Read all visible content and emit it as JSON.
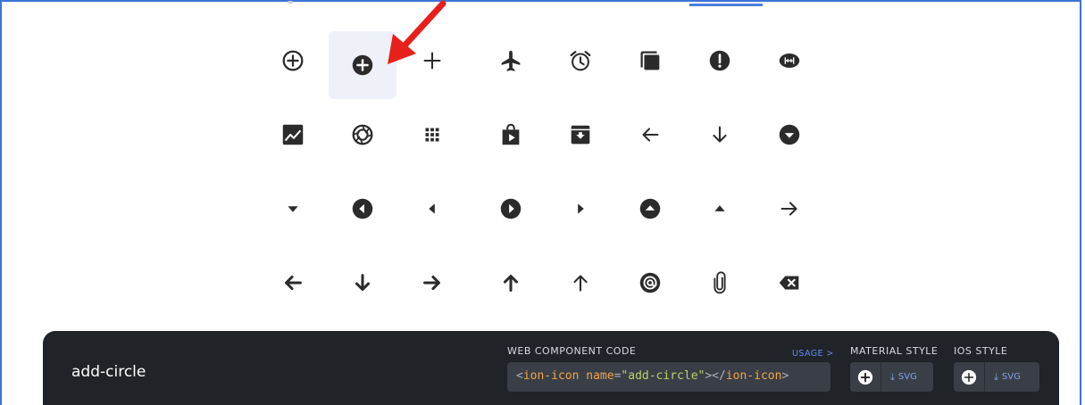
{
  "icon_grid": {
    "rows": [
      [
        "add-circle-outline-icon",
        "add-circle-icon",
        "add-icon",
        "airplane-icon",
        "alarm-icon",
        "albums-icon",
        "alert-circle-icon",
        "american-football-icon"
      ],
      [
        "analytics-icon",
        "aperture-icon",
        "apps-icon",
        "appstore-icon",
        "archive-icon",
        "arrow-back-icon",
        "arrow-down-icon",
        "arrow-dropdown-circle-icon"
      ],
      [
        "arrow-dropdown-icon",
        "arrow-dropleft-circle-icon",
        "arrow-dropleft-icon",
        "arrow-dropright-circle-icon",
        "arrow-dropright-icon",
        "arrow-dropup-circle-icon",
        "arrow-dropup-icon",
        "arrow-forward-icon"
      ],
      [
        "arrow-round-back-icon",
        "arrow-round-down-icon",
        "arrow-round-forward-icon",
        "arrow-round-up-icon",
        "arrow-up-icon",
        "at-icon",
        "attach-icon",
        "backspace-icon"
      ]
    ],
    "selected": "add-circle-icon"
  },
  "colors": {
    "icon": "#2b2b2b",
    "selected_bg": "#eef1f7",
    "annotation_arrow": "#e8201b",
    "bar_bg": "#202328",
    "accent": "#5f8df0"
  },
  "detail_bar": {
    "icon_name": "add-circle",
    "web_component_label": "WEB COMPONENT CODE",
    "usage_link": "USAGE >",
    "code": {
      "open_bracket": "<",
      "tag": "ion-icon",
      "attr": "name",
      "equals": "=",
      "value": "\"add-circle\"",
      "close_open": "></",
      "close_tag": "ion-icon",
      "close_bracket": ">"
    },
    "material_label": "MATERIAL STYLE",
    "ios_label": "IOS STYLE",
    "svg_label": "SVG"
  }
}
